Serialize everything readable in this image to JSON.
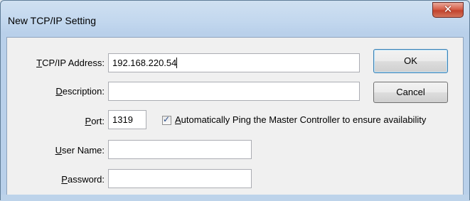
{
  "window": {
    "title": "New TCP/IP Setting",
    "close_glyph": "✕"
  },
  "form": {
    "tcpip_address": {
      "label_u": "T",
      "label_rest": "CP/IP Address:",
      "value": "192.168.220.54"
    },
    "description": {
      "label_u": "D",
      "label_rest": "escription:",
      "value": ""
    },
    "port": {
      "label_u": "P",
      "label_rest": "ort:",
      "value": "1319"
    },
    "ping": {
      "checked": true,
      "label_u": "A",
      "label_rest": "utomatically Ping the Master Controller to ensure availability"
    },
    "user_name": {
      "label_u": "U",
      "label_rest": "ser Name:",
      "value": ""
    },
    "password": {
      "label_u": "P",
      "label_rest": "assword:",
      "value": ""
    }
  },
  "buttons": {
    "ok": "OK",
    "cancel": "Cancel"
  },
  "icons": {
    "close": "close-icon",
    "check": "check-icon"
  }
}
